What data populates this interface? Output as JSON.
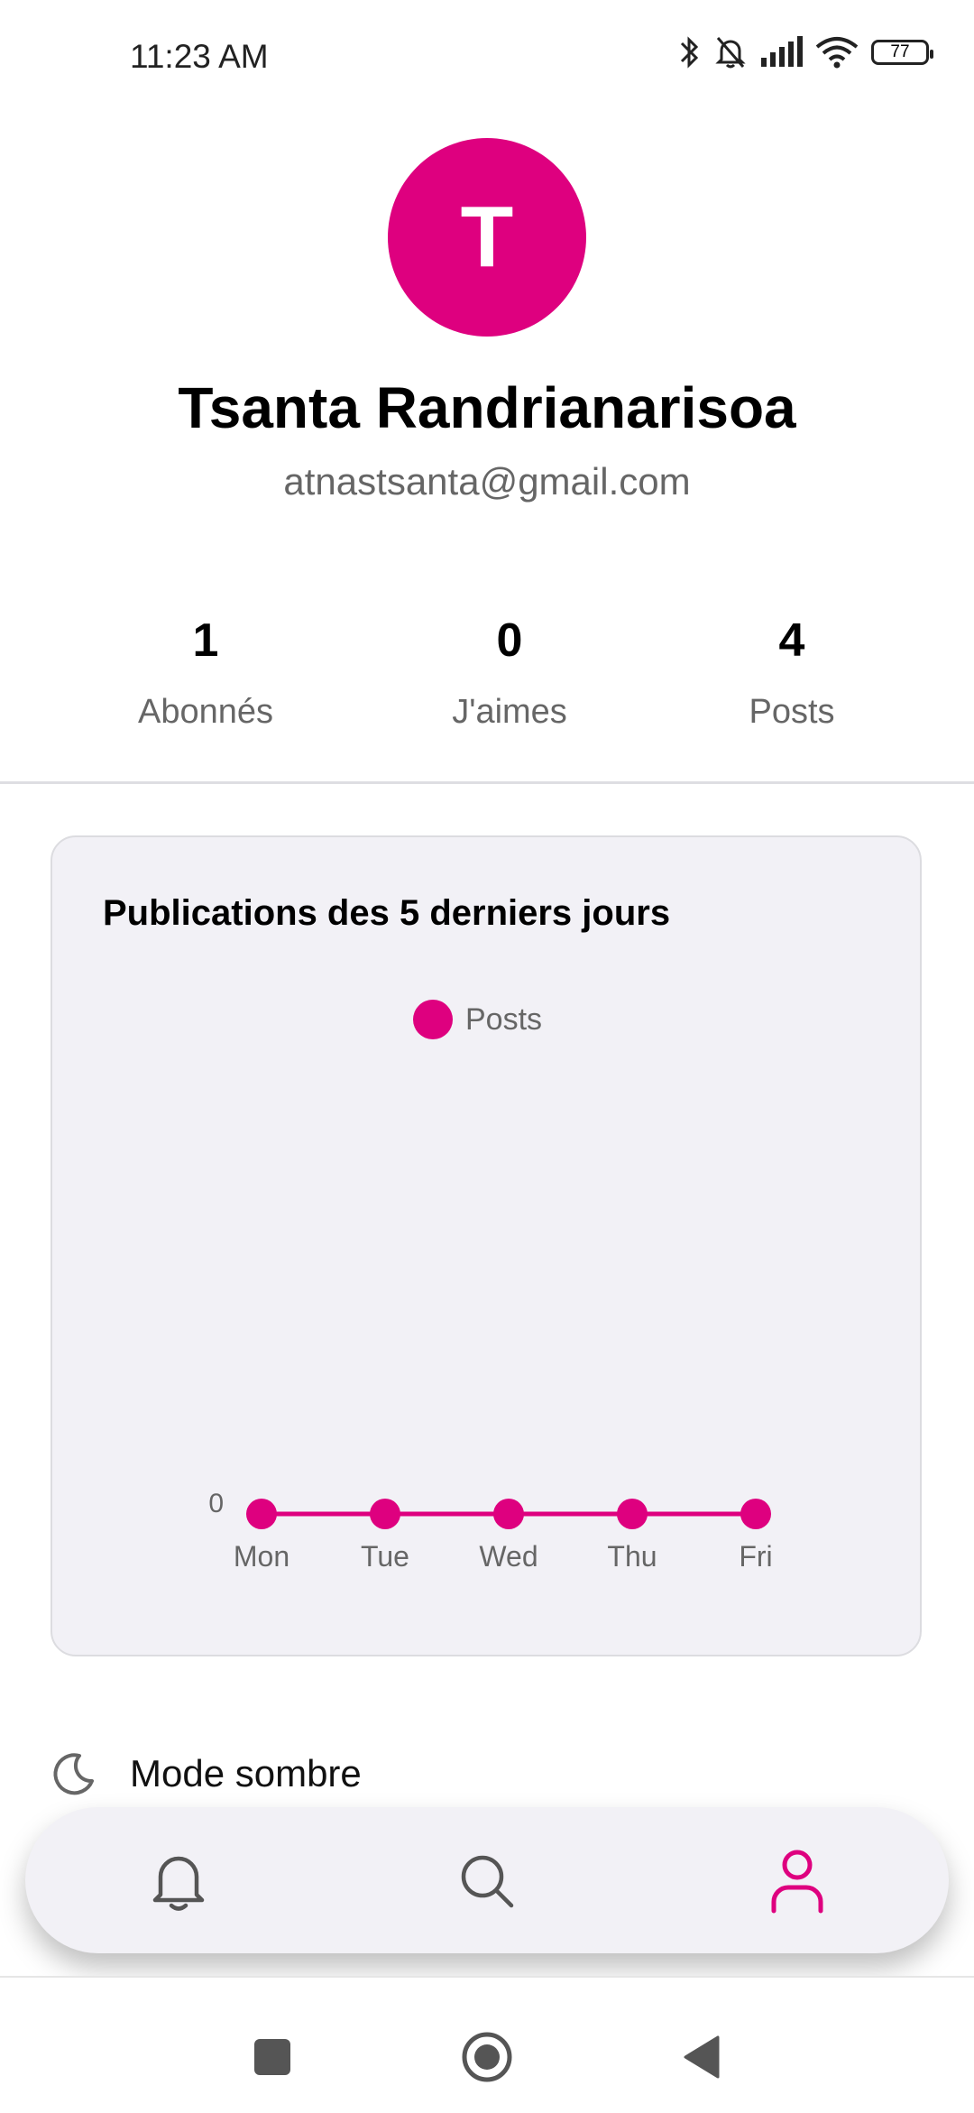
{
  "status_bar": {
    "time": "11:23 AM",
    "battery": "77",
    "icons": [
      "bluetooth-icon",
      "bell-muted-icon",
      "signal-icon",
      "wifi-icon",
      "battery-icon"
    ]
  },
  "profile": {
    "avatar_initial": "T",
    "avatar_color": "#de007f",
    "name": "Tsanta Randrianarisoa",
    "email": "atnastsanta@gmail.com"
  },
  "stats": [
    {
      "value": "1",
      "label": "Abonnés"
    },
    {
      "value": "0",
      "label": "J'aimes"
    },
    {
      "value": "4",
      "label": "Posts"
    }
  ],
  "chart_card": {
    "title": "Publications des 5 derniers jours"
  },
  "chart_data": {
    "type": "line",
    "title": "Publications des 5 derniers jours",
    "categories": [
      "Mon",
      "Tue",
      "Wed",
      "Thu",
      "Fri"
    ],
    "series": [
      {
        "name": "Posts",
        "color": "#de007f",
        "values": [
          0,
          0,
          0,
          0,
          0
        ]
      }
    ],
    "y_tick_labels": [
      "0"
    ],
    "legend_position": "top-center"
  },
  "settings": {
    "dark_mode_label": "Mode sombre",
    "dark_mode_icon": "moon-icon"
  },
  "bottom_nav": {
    "items": [
      {
        "icon": "bell-icon",
        "active": false
      },
      {
        "icon": "search-icon",
        "active": false
      },
      {
        "icon": "user-icon",
        "active": true
      }
    ],
    "active_color": "#de007f"
  },
  "system_nav": [
    "square-icon",
    "circle-home-icon",
    "back-triangle-icon"
  ]
}
